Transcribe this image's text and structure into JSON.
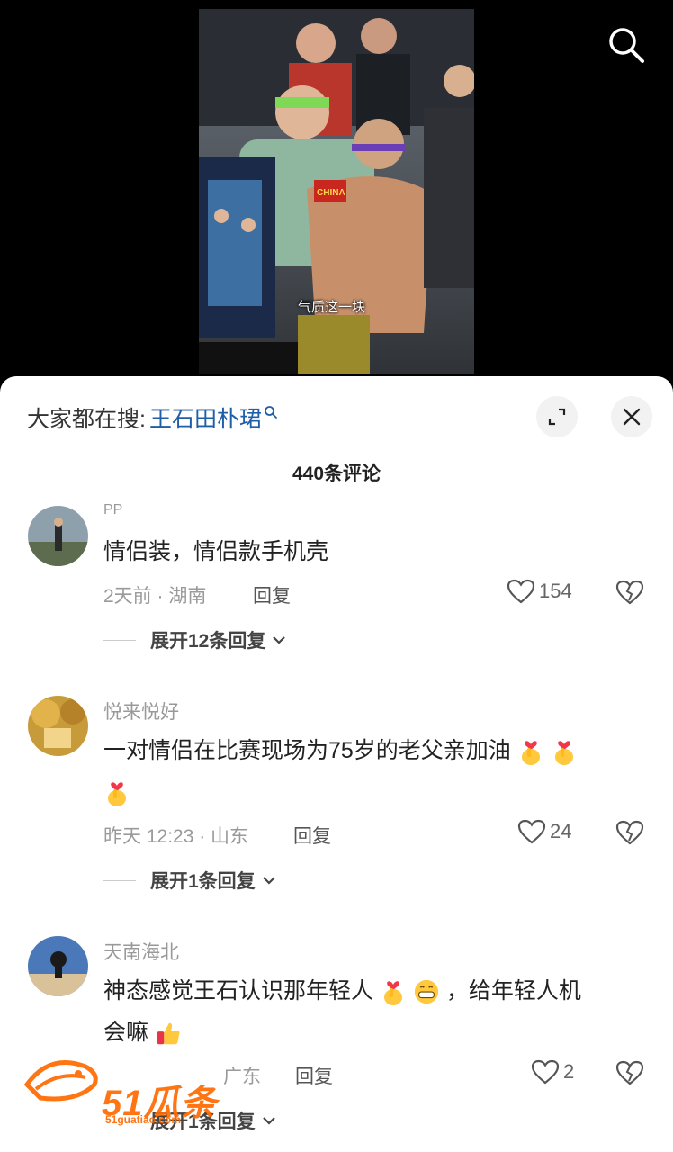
{
  "video": {
    "caption": "气质这一块",
    "jersey_text": "CHINA"
  },
  "search": {
    "icon": "search-icon"
  },
  "sheet": {
    "hot_search_prefix": "大家都在搜:",
    "hot_search_keyword": "王石田朴珺",
    "comment_count": "440条评论"
  },
  "comments": [
    {
      "user": "PP",
      "text": "情侣装，情侣款手机壳",
      "time_location": "2天前 · 湖南",
      "reply_label": "回复",
      "likes": "154",
      "expand_label": "展开12条回复"
    },
    {
      "user": "悦来悦好",
      "text": "一对情侣在比赛现场为75岁的老父亲加油",
      "emojis": [
        "finger-heart-emoji",
        "finger-heart-emoji",
        "finger-heart-emoji"
      ],
      "time_location": "昨天 12:23 · 山东",
      "reply_label": "回复",
      "likes": "24",
      "expand_label": "展开1条回复"
    },
    {
      "user": "天南海北",
      "text_part1": "神态感觉王石认识那年轻人",
      "text_part2": "，给年轻人机",
      "text_part3": "会嘛",
      "emojis": [
        "finger-heart-emoji",
        "grin-emoji",
        "thumbs-up-emoji"
      ],
      "time_location": "广东",
      "reply_label": "回复",
      "likes": "2",
      "expand_label": "展开1条回复"
    }
  ],
  "watermark": {
    "brand": "51瓜条",
    "domain": "51guatiao.com"
  },
  "colors": {
    "keyword": "#1f5fa8",
    "watermark": "#ff6a00"
  }
}
